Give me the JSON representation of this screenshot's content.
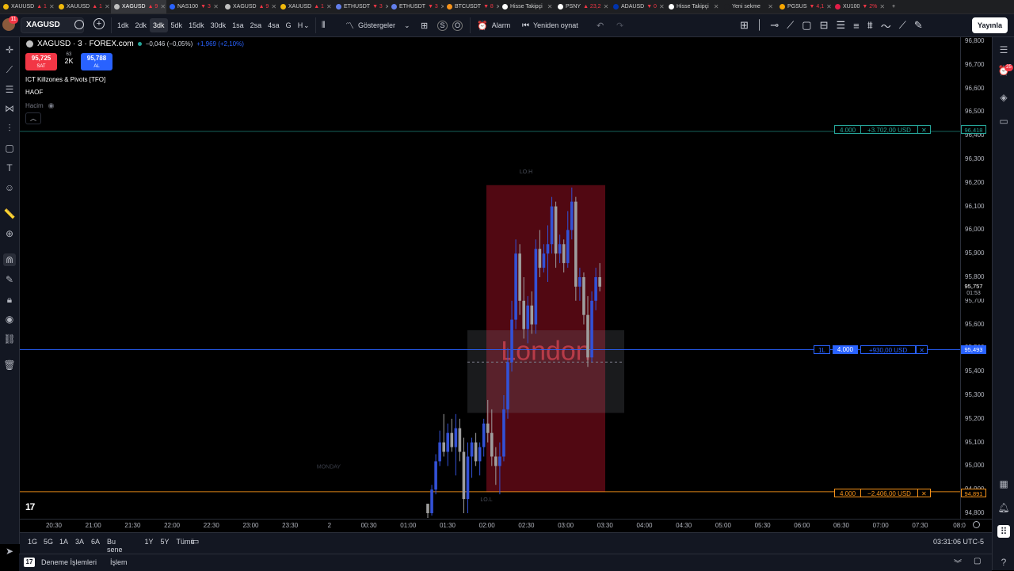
{
  "browser_tabs": [
    {
      "label": "XAUUSD",
      "change": "▲ 1",
      "color": "#f0b90b"
    },
    {
      "label": "XAUUSD",
      "change": "▲ 1",
      "color": "#f0b90b"
    },
    {
      "label": "XAGUSD",
      "change": "▲ 9",
      "color": "#c0c0c0",
      "active": true
    },
    {
      "label": "NAS100",
      "change": "▼ 3",
      "color": "#2962ff"
    },
    {
      "label": "XAGUSD",
      "change": "▲ 9",
      "color": "#c0c0c0"
    },
    {
      "label": "XAUUSD",
      "change": "▲ 1",
      "color": "#f0b90b"
    },
    {
      "label": "ETHUSDT",
      "change": "▼ 3",
      "color": "#627eea"
    },
    {
      "label": "ETHUSDT",
      "change": "▼ 3",
      "color": "#627eea"
    },
    {
      "label": "BTCUSDT",
      "change": "▼ 8",
      "color": "#f7931a"
    },
    {
      "label": "Hisse Takipçi",
      "change": "",
      "color": "#ffffff"
    },
    {
      "label": "PSNY",
      "change": "▲ 23,2",
      "color": "#ffffff"
    },
    {
      "label": "ADAUSD",
      "change": "▼ 0",
      "color": "#0033ad"
    },
    {
      "label": "Hisse Takipçi",
      "change": "",
      "color": "#ffffff"
    },
    {
      "label": "Yeni sekme",
      "change": "",
      "color": "#1e1f22"
    },
    {
      "label": "PGSUS",
      "change": "▼ 4,1",
      "color": "#f7a600"
    },
    {
      "label": "XU100",
      "change": "▼ 2%",
      "color": "#e11d48"
    }
  ],
  "toolbar": {
    "notif_count": "11",
    "symbol": "XAGUSD",
    "intervals": [
      "1dk",
      "2dk",
      "3dk",
      "5dk",
      "15dk",
      "30dk",
      "1sa",
      "2sa",
      "4sa",
      "G",
      "H"
    ],
    "selected_interval": "3dk",
    "indicators_label": "Göstergeler",
    "alarm_label": "Alarm",
    "replay_label": "Yeniden oynat",
    "publish_label": "Yayınla"
  },
  "legend": {
    "title": "XAGUSD · 3 · FOREX.com",
    "change_abs": "−0,046 (−0,05%)",
    "change_day": "+1,969 (+2,10%)",
    "sell_price": "95,725",
    "sell_label": "SAT",
    "spread": "63",
    "qty": "2K",
    "buy_price": "95,788",
    "buy_label": "AL",
    "indicator1": "ICT Killzones & Pivots [TFO]",
    "indicator2": "HAOF",
    "indicator3": "Hacim",
    "collapse_icon": "chevron-up-icon"
  },
  "chart_data": {
    "type": "candlestick",
    "y_ticks": [
      "96,800",
      "96,700",
      "96,600",
      "96,500",
      "96,400",
      "96,300",
      "96,200",
      "96,100",
      "96,000",
      "95,900",
      "95,800",
      "95,700",
      "95,600",
      "95,500",
      "95,400",
      "95,300",
      "95,200",
      "95,100",
      "95,000",
      "94,900",
      "94,800"
    ],
    "x_ticks": [
      "20:30",
      "21:00",
      "21:30",
      "22:00",
      "22:30",
      "23:00",
      "23:30",
      "2",
      "00:30",
      "01:00",
      "01:30",
      "02:00",
      "02:30",
      "03:00",
      "03:30",
      "04:00",
      "04:30",
      "05:00",
      "05:30",
      "06:00",
      "06:30",
      "07:00",
      "07:30",
      "08:0"
    ],
    "killzone_label": "London",
    "killzone_high_label": "LO.H",
    "killzone_low_label": "LO.L",
    "day_label": "MONDAY",
    "current_price": "95,757",
    "countdown": "01:53",
    "lines": [
      {
        "price": "96,418",
        "qty": "4.000",
        "pnl": "+3.702,00 USD",
        "color": "#26a69a"
      },
      {
        "price": "95,493",
        "qty": "4.000",
        "pnl": "+930,00 USD",
        "color": "#2962ff",
        "side": "1L"
      },
      {
        "price": "94,891",
        "qty": "4.000",
        "pnl": "−2.406,00 USD",
        "color": "#f7931a"
      }
    ],
    "candles": [
      [
        0,
        94.84,
        94.84,
        94.78,
        94.8
      ],
      [
        1,
        94.8,
        94.92,
        94.79,
        94.9
      ],
      [
        2,
        94.9,
        95.05,
        94.88,
        95.02
      ],
      [
        3,
        95.02,
        95.15,
        95.0,
        95.1
      ],
      [
        4,
        95.1,
        95.22,
        95.04,
        95.06
      ],
      [
        5,
        95.06,
        95.18,
        95.0,
        95.14
      ],
      [
        6,
        95.14,
        95.2,
        95.06,
        95.08
      ],
      [
        7,
        95.08,
        95.22,
        94.96,
        95.16
      ],
      [
        8,
        95.16,
        95.2,
        95.02,
        95.06
      ],
      [
        9,
        95.06,
        95.12,
        94.8,
        94.86
      ],
      [
        10,
        94.86,
        95.1,
        94.8,
        95.04
      ],
      [
        11,
        95.04,
        95.12,
        94.95,
        95.1
      ],
      [
        12,
        95.1,
        95.14,
        95.0,
        95.02
      ],
      [
        13,
        95.02,
        95.1,
        94.96,
        95.08
      ],
      [
        14,
        95.08,
        95.2,
        95.04,
        95.18
      ],
      [
        15,
        95.18,
        95.28,
        95.1,
        95.14
      ],
      [
        16,
        95.14,
        95.24,
        95.0,
        95.04
      ],
      [
        17,
        95.04,
        95.08,
        94.92,
        95.0
      ],
      [
        18,
        95.0,
        95.1,
        94.88,
        95.04
      ],
      [
        19,
        95.04,
        95.3,
        95.02,
        95.24
      ],
      [
        20,
        95.24,
        95.5,
        95.2,
        95.44
      ],
      [
        21,
        95.44,
        95.7,
        95.4,
        95.62
      ],
      [
        22,
        95.62,
        95.96,
        95.58,
        95.9
      ],
      [
        23,
        95.9,
        95.94,
        95.64,
        95.7
      ],
      [
        24,
        95.7,
        95.8,
        95.54,
        95.58
      ],
      [
        25,
        95.58,
        95.72,
        95.52,
        95.68
      ],
      [
        26,
        95.68,
        95.74,
        95.56,
        95.6
      ],
      [
        27,
        95.6,
        95.96,
        95.56,
        95.92
      ],
      [
        28,
        95.92,
        96.0,
        95.8,
        95.84
      ],
      [
        29,
        95.84,
        95.94,
        95.82,
        95.9
      ],
      [
        30,
        95.9,
        96.02,
        95.78,
        95.94
      ],
      [
        31,
        95.94,
        96.14,
        95.9,
        96.1
      ],
      [
        32,
        96.1,
        96.12,
        95.84,
        95.9
      ],
      [
        33,
        95.9,
        95.98,
        95.86,
        95.94
      ],
      [
        34,
        95.94,
        95.96,
        95.82,
        95.86
      ],
      [
        35,
        95.86,
        96.08,
        95.84,
        96.0
      ],
      [
        36,
        96.0,
        96.18,
        95.96,
        96.12
      ],
      [
        37,
        96.12,
        96.14,
        95.7,
        95.76
      ],
      [
        38,
        95.76,
        95.84,
        95.7,
        95.8
      ],
      [
        39,
        95.8,
        95.82,
        95.6,
        95.64
      ],
      [
        40,
        95.64,
        95.72,
        95.42,
        95.46
      ],
      [
        41,
        95.46,
        95.74,
        95.44,
        95.7
      ],
      [
        42,
        95.7,
        95.84,
        95.66,
        95.8
      ],
      [
        43,
        95.8,
        95.86,
        95.74,
        95.76
      ]
    ]
  },
  "price_axis_tags": {
    "top_tag": "96,418",
    "mid_tag": "95,493",
    "low_tag": "94,891"
  },
  "range_bar": {
    "ranges": [
      "1G",
      "5G",
      "1A",
      "3A",
      "6A",
      "Bu sene",
      "1Y",
      "5Y",
      "Tümü"
    ],
    "clock": "03:31:06 UTC-5"
  },
  "bottom_bar": {
    "tab1": "Deneme İşlemleri",
    "tab2": "İşlem"
  },
  "right_toolbar_badge": "25"
}
